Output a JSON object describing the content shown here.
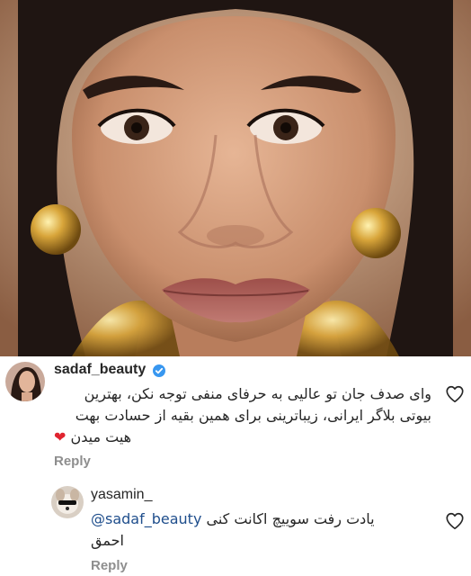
{
  "post_image": {
    "alt": ""
  },
  "comments": [
    {
      "username": "sadaf_beauty",
      "verified": true,
      "text_line1": "وای صدف جان تو عالیی به حرفای منفی توجه نکن، بهترین",
      "text_line2": "بیوتی بلاگر ایرانی، زیباترینی برای همین بقیه از حسادت بهت",
      "text_line3": "هیت میدن",
      "emoji": "❤",
      "reply_label": "Reply",
      "like_icon": "heart-outline-icon"
    },
    {
      "username": "yasamin_",
      "mention": "@sadaf_beauty",
      "text_line1": "یادت رفت سوییچ اکانت کنی",
      "text_line2": "احمق",
      "reply_label": "Reply",
      "like_icon": "heart-outline-icon"
    }
  ],
  "colors": {
    "verified_badge": "#3897f0",
    "mention": "#1f4e8c",
    "secondary_text": "#8e8e8e",
    "heart_emoji": "#e0242f"
  }
}
